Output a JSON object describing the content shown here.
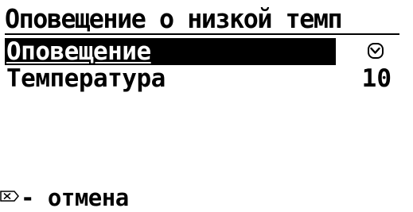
{
  "screen": {
    "title": "Оповещение о низкой темп",
    "rows": [
      {
        "label": "Оповещение",
        "value_icon": "checkbox-checked-icon",
        "selected": true
      },
      {
        "label": "Температура",
        "value": "10",
        "selected": false
      }
    ],
    "footer": {
      "key_icon": "cancel-key-icon",
      "label": "- отмена"
    }
  },
  "colors": {
    "background": "#ffffff",
    "foreground": "#000000",
    "selection": "#000000"
  }
}
